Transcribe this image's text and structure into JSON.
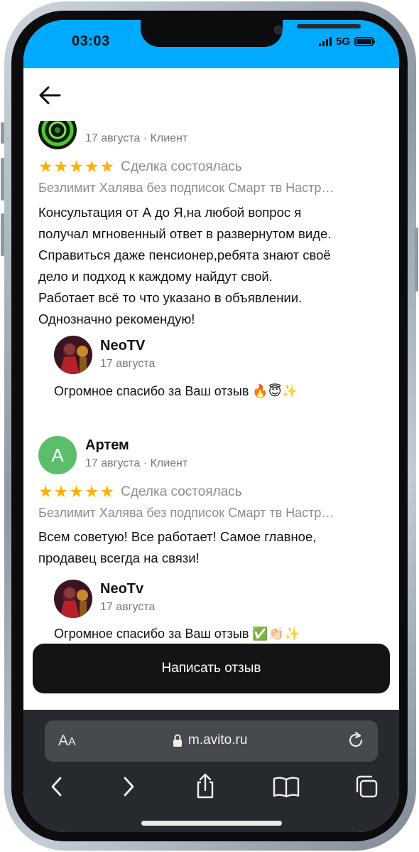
{
  "status_bar": {
    "time": "03:03",
    "network": "5G",
    "bg_color": "#00aaff"
  },
  "reviews": [
    {
      "author": "",
      "date_role": "17 августа · Клиент",
      "stars": 5,
      "deal_status": "Сделка состоялась",
      "product": "Безлимит Халява без подписок Смарт тв Настр…",
      "text_lines": [
        "Консультация от А до Я,на любой вопрос я",
        "получал мгновенный ответ в развернутом виде.",
        "Справиться даже пенсионер,ребята знают своё",
        "дело и подход к каждому найдут свой.",
        "Работает всё то что указано в объявлении.",
        "Однозначно рекомендую!"
      ],
      "reply": {
        "name": "NeoTV",
        "date": "17 августа",
        "text": "Огромное спасибо за Ваш отзыв 🔥😇✨"
      }
    },
    {
      "author": "Артем",
      "avatar_letter": "А",
      "date_role": "17 августа · Клиент",
      "stars": 5,
      "deal_status": "Сделка состоялась",
      "product": "Безлимит Халява без подписок Смарт тв Настр…",
      "text_lines": [
        "Всем советую! Все работает! Самое главное,",
        "продавец всегда на связи!"
      ],
      "reply": {
        "name": "NeoTv",
        "date": "17 августа",
        "text": "Огромное спасибо за Ваш отзыв ✅👏🏻✨"
      }
    }
  ],
  "cta": {
    "label": "Написать отзыв"
  },
  "browser": {
    "aa_big": "A",
    "aa_small": "A",
    "url": "m.avito.ru"
  },
  "icons": {
    "back": "arrow-left-icon",
    "lock": "lock-icon",
    "reload": "reload-icon",
    "nav": [
      "chevron-left-icon",
      "chevron-right-icon",
      "share-icon",
      "book-icon",
      "tabs-icon"
    ]
  },
  "colors": {
    "star": "#ffb000",
    "avatar_green": "#5cbd6a",
    "cta_bg": "#141414",
    "safari_bg": "#262a2f"
  }
}
